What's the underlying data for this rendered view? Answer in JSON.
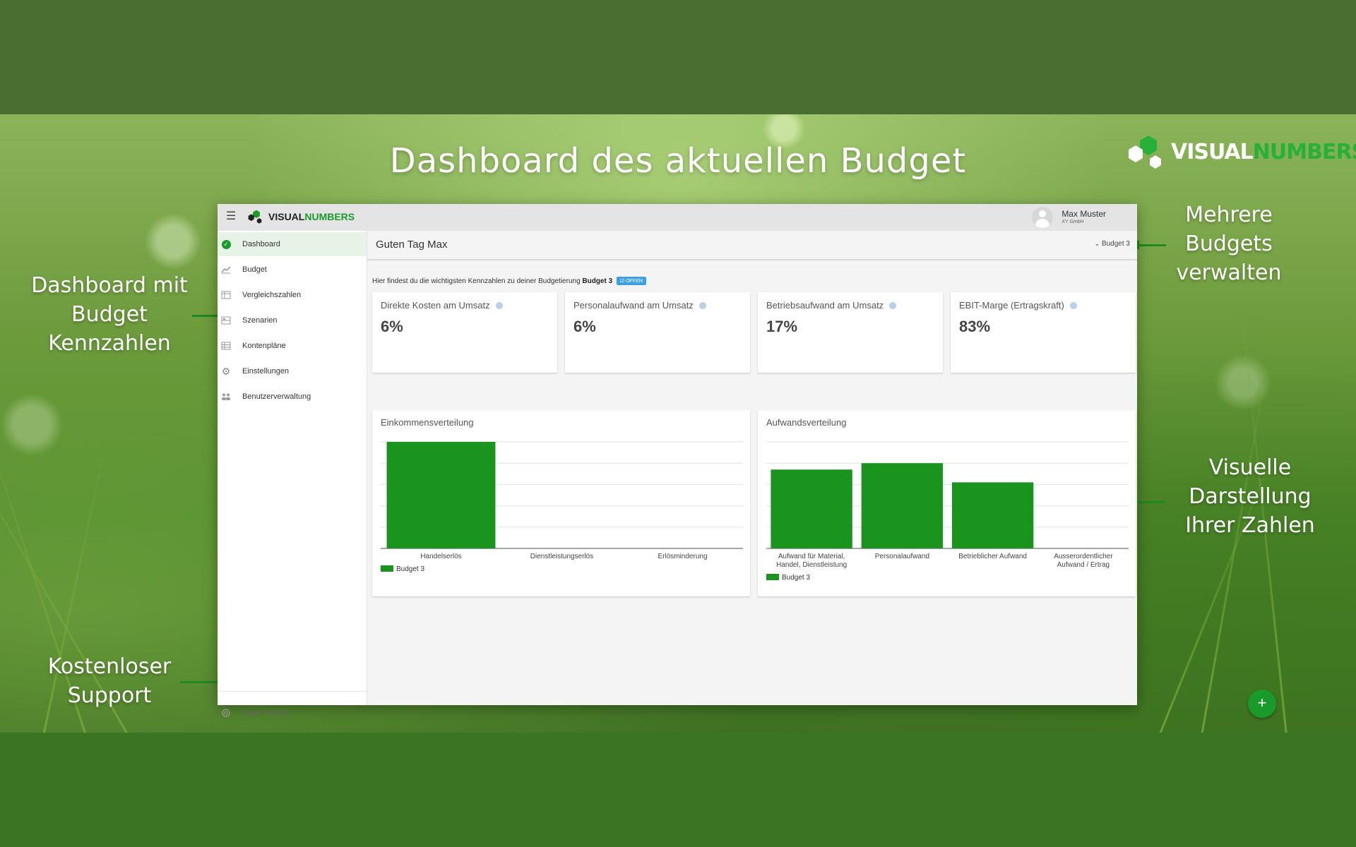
{
  "hero": {
    "title": "Dashboard des aktuellen Budget",
    "brand": {
      "text_white": "VISUAL",
      "text_green": "NUMBERS"
    }
  },
  "callouts": {
    "left_top": [
      "Dashboard mit",
      "Budget",
      "Kennzahlen"
    ],
    "left_bottom": [
      "Kostenloser",
      "Support"
    ],
    "right_top": [
      "Mehrere",
      "Budgets",
      "verwalten"
    ],
    "right_bottom": [
      "Visuelle",
      "Darstellung",
      "Ihrer Zahlen"
    ]
  },
  "colors": {
    "accent": "#1a9a2a",
    "bar": "#1a931f",
    "badge": "#3fa0e0"
  },
  "app": {
    "logo": {
      "text_white": "VISUAL",
      "text_green": "NUMBERS"
    },
    "user": {
      "name": "Max Muster",
      "company": "XY GmbH"
    },
    "sidebar": {
      "items": [
        {
          "label": "Dashboard",
          "icon": "check-circle-icon",
          "active": true
        },
        {
          "label": "Budget",
          "icon": "chart-icon"
        },
        {
          "label": "Vergleichszahlen",
          "icon": "table-icon"
        },
        {
          "label": "Szenarien",
          "icon": "layers-icon"
        },
        {
          "label": "Kontenpläne",
          "icon": "grid-icon"
        },
        {
          "label": "Einstellungen",
          "icon": "gear-icon"
        },
        {
          "label": "Benutzerverwaltung",
          "icon": "users-icon"
        }
      ],
      "support": "Support & FAQ"
    },
    "greeting": "Guten Tag Max",
    "budget_select": "Budget 3",
    "intro_text": "Hier findest du die wichtigsten Kennzahlen zu deiner Budgetierung",
    "intro_budget": "Budget 3",
    "status_badge": "OFFEN",
    "kpis": [
      {
        "title": "Direkte Kosten am Umsatz",
        "value": "6%"
      },
      {
        "title": "Personalaufwand am Umsatz",
        "value": "6%"
      },
      {
        "title": "Betriebsaufwand am Umsatz",
        "value": "17%"
      },
      {
        "title": "EBIT-Marge (Ertragskraft)",
        "value": "83%"
      }
    ],
    "fab_label": "+"
  },
  "chart_data": [
    {
      "type": "bar",
      "title": "Einkommensverteilung",
      "categories": [
        "Handelserlös",
        "Dienstleistungserlös",
        "Erlösminderung"
      ],
      "series": [
        {
          "name": "Budget 3",
          "values": [
            100,
            0,
            0
          ]
        }
      ],
      "ylim": [
        0,
        100
      ],
      "grid": true,
      "legend": "bottom-left"
    },
    {
      "type": "bar",
      "title": "Aufwandsverteilung",
      "categories": [
        "Aufwand für Material, Handel, Dienstleistung",
        "Personalaufwand",
        "Betrieblicher Aufwand",
        "Ausserordentlicher Aufwand / Ertrag"
      ],
      "category_lines": [
        [
          "Aufwand für Material,",
          "Handel, Dienstleistung"
        ],
        [
          "Personalaufwand"
        ],
        [
          "Betrieblicher Aufwand"
        ],
        [
          "Ausserordentlicher",
          "Aufwand / Ertrag"
        ]
      ],
      "series": [
        {
          "name": "Budget 3",
          "values": [
            74,
            80,
            62,
            0
          ]
        }
      ],
      "ylim": [
        0,
        100
      ],
      "grid": true,
      "legend": "bottom-left"
    }
  ]
}
